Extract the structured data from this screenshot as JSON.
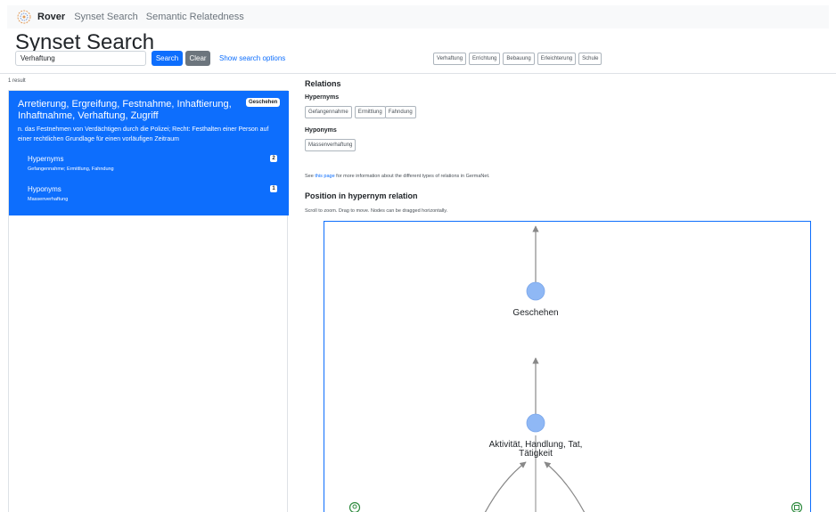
{
  "nav": {
    "brand": "Rover",
    "links": [
      "Synset Search",
      "Semantic Relatedness"
    ]
  },
  "page_title": "Synset Search",
  "search": {
    "value": "Verhaftung",
    "search_label": "Search",
    "clear_label": "Clear",
    "options_label": "Show search options"
  },
  "history": [
    "Verhaftung",
    "Errichtung",
    "Bebauung",
    "Erleichterung",
    "Schule"
  ],
  "results": {
    "count_label": "1 result",
    "items": [
      {
        "title": "Arretierung, Ergreifung, Festnahme, Inhaftierung, Inhaftnahme, Verhaftung, Zugriff",
        "category": "Geschehen",
        "definition": "n. das Festnehmen von Verdächtigen durch die Polizei; Recht: Festhalten einer Person auf einer rechtlichen Grundlage für einen vorläufigen Zeitraum",
        "relations": [
          {
            "name": "Hypernyms",
            "count": "2",
            "items": "Gefangennahme; Ermittlung, Fahndung"
          },
          {
            "name": "Hyponyms",
            "count": "1",
            "items": "Massenverhaftung"
          }
        ]
      }
    ]
  },
  "relations": {
    "title": "Relations",
    "hypernyms_label": "Hypernyms",
    "hypernyms": [
      "Gefangennahme",
      "Ermittlung",
      "Fahndung"
    ],
    "hyponyms_label": "Hyponyms",
    "hyponyms": [
      "Massenverhaftung"
    ],
    "info_prefix": "See ",
    "info_link": "this page",
    "info_suffix": " for more information about the different types of relations in GermaNet."
  },
  "position": {
    "title": "Position in hypernym relation",
    "hint": "Scroll to zoom. Drag to move. Nodes can be dragged horizontally.",
    "nodes": [
      {
        "label": "Geschehen"
      },
      {
        "label_line1": "Aktivität, Handlung, Tat,",
        "label_line2": "Tätigkeit"
      }
    ],
    "colors": {
      "node": "#8fb8f5",
      "edge": "#888888",
      "border": "#0d6efd"
    },
    "corner_icons": [
      "node-icon",
      "node-icon"
    ]
  },
  "colors": {
    "primary": "#0d6efd",
    "secondary": "#6c757d",
    "navbar": "#f8f9fa"
  }
}
